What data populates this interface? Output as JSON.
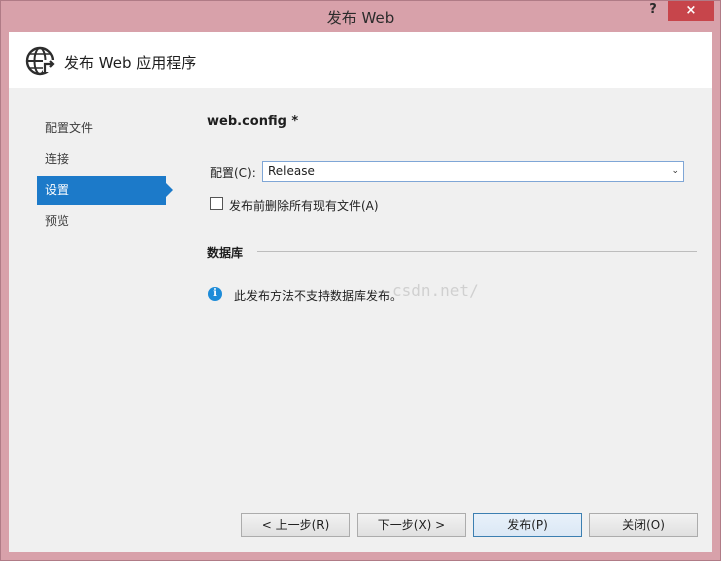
{
  "window": {
    "title": "发布 Web",
    "help_glyph": "?",
    "close_glyph": "×"
  },
  "header": {
    "title": "发布 Web 应用程序",
    "icon": "globe-publish-icon"
  },
  "nav": {
    "items": [
      {
        "label": "配置文件"
      },
      {
        "label": "连接"
      },
      {
        "label": "设置"
      },
      {
        "label": "预览"
      }
    ],
    "active_index": 2
  },
  "settings": {
    "section_title": "web.config *",
    "config_label": "配置(C):",
    "config_value": "Release",
    "config_arrow": "⌄",
    "delete_label": "发布前删除所有现有文件(A)",
    "delete_checked": false,
    "db_title": "数据库",
    "info_glyph": "i",
    "info_text": "此发布方法不支持数据库发布。",
    "watermark": "csdn.net/"
  },
  "buttons": {
    "prev": "< 上一步(R)",
    "next": "下一步(X) >",
    "publish": "发布(P)",
    "close": "关闭(O)"
  },
  "colors": {
    "frame": "#d8a1aa",
    "accent": "#1c7ac9",
    "close_red": "#c7454b",
    "info_blue": "#1d8bd8"
  }
}
